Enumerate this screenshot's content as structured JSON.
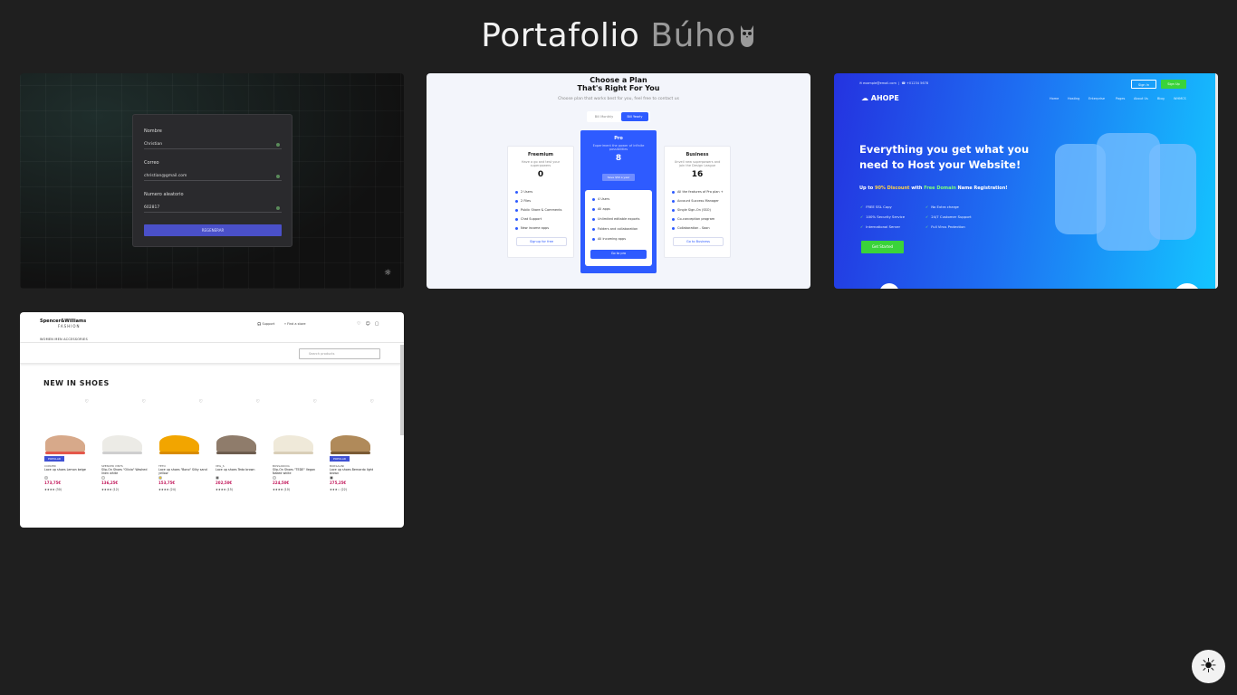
{
  "header": {
    "title_main": "Portafolio",
    "title_accent": "Búho",
    "owl_icon": "owl-icon"
  },
  "cards": {
    "form": {
      "name_label": "Nombre",
      "name_value": "Christian",
      "email_label": "Correo",
      "email_value": "christian@gmail.com",
      "number_label": "Numero aleatorio",
      "number_value": "602817",
      "button_label": "REGENERAR",
      "theme_icon": "sun-icon"
    },
    "pricing": {
      "title_line1": "Choose a Plan",
      "title_line2": "That's Right For You",
      "subtitle": "Choose plan that works best for you, feel free to contact us",
      "toggle_monthly": "Bill Monthly",
      "toggle_yearly": "Bill Yearly",
      "plans": [
        {
          "name": "Freemium",
          "desc": "Have a go and test your superpowers",
          "price": "0",
          "features": [
            "2 Users",
            "2 Files",
            "Public Share & Comments",
            "Chat Support",
            "New income apps"
          ],
          "cta": "Signup for free"
        },
        {
          "name": "Pro",
          "desc": "Experiment the power of infinite possibilities",
          "price": "8",
          "save": "Save $50 a year",
          "features": [
            "4 Users",
            "All apps",
            "Unlimited editable exports",
            "Folders and collaboration",
            "All incoming apps"
          ],
          "cta": "Go to pro"
        },
        {
          "name": "Business",
          "desc": "Unveil new superpowers and join the Design League",
          "price": "16",
          "features": [
            "All the features of Pro plan +",
            "Account Success Manager",
            "Single Sign-On (SSO)",
            "Co-conception program",
            "Collaboration - Soon"
          ],
          "cta": "Go to Business"
        }
      ]
    },
    "hosting": {
      "email": "example@email.com",
      "phone": "+01234 5678",
      "signin1": "Sign In",
      "signup": "Sign Up",
      "brand": "AHOPE",
      "nav": [
        "Home",
        "Hosting",
        "Enterprise",
        "Pages",
        "About Us",
        "Blog",
        "WHMCS"
      ],
      "headline": "Everything you get what you need to Host your Website!",
      "offer_pre": "Up to",
      "offer_discount": "90% Discount",
      "offer_mid": "with",
      "offer_domain": "Free Domain",
      "offer_post": "Name Registration!",
      "features": [
        "FREE SSL Copy",
        "No Extra charge",
        "100% Security Service",
        "24/7 Customer Support",
        "International Server",
        "Full Virus Protection"
      ],
      "cta": "Get Started",
      "colors": {
        "grad_start": "#2433e0",
        "grad_end": "#14c6ff",
        "cta": "#3ad33a"
      }
    },
    "shop": {
      "brand": "Spencer&Williams",
      "brand_sub": "FASHION",
      "link_support": "Support",
      "link_stores": "Find a store",
      "nav": "WOMEN    MEN    ACCESSORIES",
      "search_placeholder": "Search products",
      "section_title": "NEW IN SHOES",
      "products": [
        {
          "brand": "CONVER",
          "name": "Lace up shoes Lemon beige",
          "price": "173,75€",
          "stars": "★★★★ (30)",
          "badge": "POPULAR",
          "shoe_color": "#d7a98a",
          "sole_color": "#e4574a",
          "dot": "#d8d8d8"
        },
        {
          "brand": "SPENCER VINTS",
          "name": "Slip-On Shoes \"Olivia\" Washed linen white",
          "price": "136,25€",
          "stars": "★★★★ (12)",
          "badge": "",
          "shoe_color": "#ecebe6",
          "sole_color": "#cfcfcf",
          "dot": "#f1f1ea"
        },
        {
          "brand": "TETO",
          "name": "Lace up shoes \"Bono\" Silky sand yellow",
          "price": "153,75€",
          "stars": "★★★★ (24)",
          "badge": "",
          "shoe_color": "#f2a500",
          "sole_color": "#d98c00",
          "dot": "#f2c200"
        },
        {
          "brand": "VEG_S",
          "name": "Lace up shoes Teda brown",
          "price": "202,50€",
          "stars": "★★★★ (15)",
          "badge": "",
          "shoe_color": "#8f7c6b",
          "sole_color": "#6d5d4f",
          "dot": "#4b4b4b"
        },
        {
          "brand": "BOSSANOVA",
          "name": "Slip-On Shoes \"TEDE\" Vegan Naked white",
          "price": "224,50€",
          "stars": "★★★★ (10)",
          "badge": "",
          "shoe_color": "#efe9d9",
          "sole_color": "#d9cfb8",
          "dot": "#efefef"
        },
        {
          "brand": "BORSALINI",
          "name": "Lace up shoes Bernardo light brown",
          "price": "275,25€",
          "stars": "★★★☆ (22)",
          "badge": "POPULAR",
          "shoe_color": "#b08a5a",
          "sole_color": "#7a5a34",
          "dot": "#333333"
        }
      ]
    }
  },
  "theme_toggle": {
    "icon": "sun-icon"
  }
}
